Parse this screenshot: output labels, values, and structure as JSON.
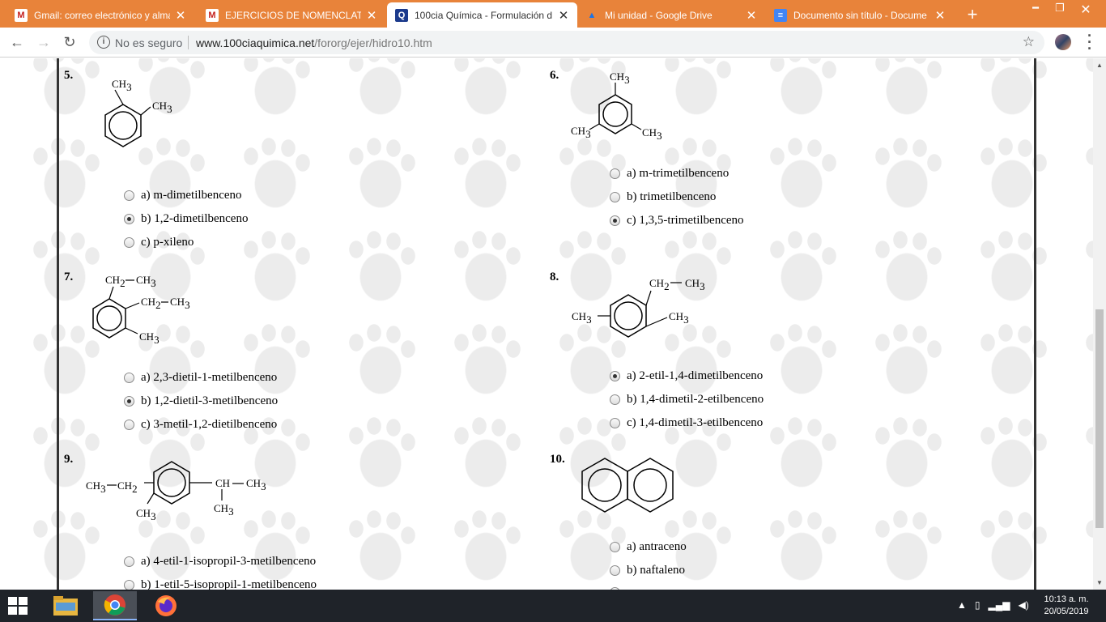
{
  "browser": {
    "tabs": [
      {
        "title": "Gmail: correo electrónico y alma",
        "icon": "gmail-icon",
        "close": "✕"
      },
      {
        "title": "EJERCICIOS DE NOMENCLATUR",
        "icon": "gmail-icon",
        "close": "✕"
      },
      {
        "title": "100cia Química - Formulación d",
        "icon": "quimica-favicon",
        "close": "✕",
        "active": true
      },
      {
        "title": "Mi unidad - Google Drive",
        "icon": "drive-icon",
        "close": "✕"
      },
      {
        "title": "Documento sin título - Docume",
        "icon": "docs-icon",
        "close": "✕"
      }
    ],
    "security_label": "No es seguro",
    "url_host": "www.100ciaquimica.net",
    "url_path": "/fororg/ejer/hidro10.htm"
  },
  "questions": [
    {
      "number": "5.",
      "options": [
        {
          "label": "a) m-dimetilbenceno",
          "checked": false
        },
        {
          "label": "b) 1,2-dimetilbenceno",
          "checked": true
        },
        {
          "label": "c) p-xileno",
          "checked": false
        }
      ]
    },
    {
      "number": "6.",
      "options": [
        {
          "label": "a) m-trimetilbenceno",
          "checked": false
        },
        {
          "label": "b) trimetilbenceno",
          "checked": false
        },
        {
          "label": "c) 1,3,5-trimetilbenceno",
          "checked": true
        }
      ]
    },
    {
      "number": "7.",
      "options": [
        {
          "label": "a) 2,3-dietil-1-metilbenceno",
          "checked": false
        },
        {
          "label": "b) 1,2-dietil-3-metilbenceno",
          "checked": true
        },
        {
          "label": "c) 3-metil-1,2-dietilbenceno",
          "checked": false
        }
      ]
    },
    {
      "number": "8.",
      "options": [
        {
          "label": "a) 2-etil-1,4-dimetilbenceno",
          "checked": true
        },
        {
          "label": "b) 1,4-dimetil-2-etilbenceno",
          "checked": false
        },
        {
          "label": "c) 1,4-dimetil-3-etilbenceno",
          "checked": false
        }
      ]
    },
    {
      "number": "9.",
      "options": [
        {
          "label": "a) 4-etil-1-isopropil-3-metilbenceno",
          "checked": false
        },
        {
          "label": "b) 1-etil-5-isopropil-1-metilbenceno",
          "checked": false
        }
      ]
    },
    {
      "number": "10.",
      "options": [
        {
          "label": "a) antraceno",
          "checked": false
        },
        {
          "label": "b) naftaleno",
          "checked": false
        }
      ]
    }
  ],
  "formula": {
    "ch": "CH",
    "ch2": "CH",
    "sub2": "2",
    "sub3": "3"
  },
  "taskbar": {
    "time": "10:13 a. m.",
    "date": "20/05/2019"
  }
}
